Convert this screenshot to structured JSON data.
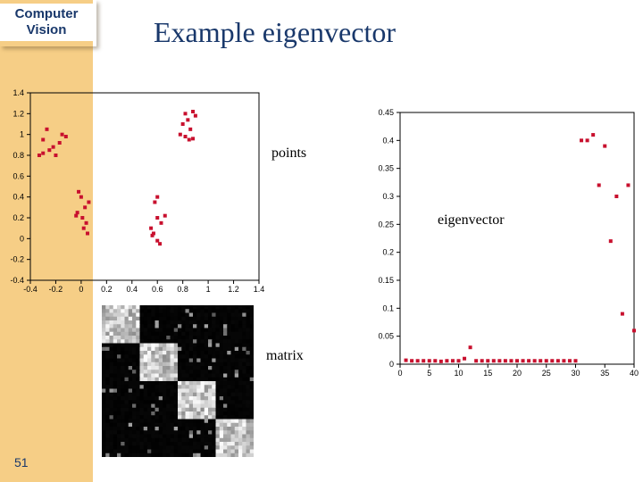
{
  "sidebar": {
    "title_line1": "Computer",
    "title_line2": "Vision",
    "page_number": "51"
  },
  "title": "Example eigenvector",
  "labels": {
    "points": "points",
    "eigenvector": "eigenvector",
    "matrix": "matrix"
  },
  "chart_data": [
    {
      "type": "scatter",
      "name": "points",
      "xlabel": "",
      "ylabel": "",
      "xlim": [
        -0.4,
        1.4
      ],
      "ylim": [
        -0.4,
        1.4
      ],
      "xticks": [
        -0.4,
        -0.2,
        0,
        0.2,
        0.4,
        0.6,
        0.8,
        1,
        1.2,
        1.4
      ],
      "yticks": [
        -0.4,
        -0.2,
        0,
        0.2,
        0.4,
        0.6,
        0.8,
        1,
        1.2,
        1.4
      ],
      "x": [
        -0.33,
        -0.3,
        -0.25,
        -0.27,
        -0.2,
        -0.15,
        -0.17,
        -0.12,
        -0.22,
        -0.3,
        -0.04,
        -0.02,
        0.02,
        0.03,
        0.05,
        -0.03,
        0.0,
        0.04,
        0.06,
        0.01,
        0.56,
        0.6,
        0.62,
        0.58,
        0.55,
        0.66,
        0.6,
        0.63,
        0.6,
        0.57,
        0.78,
        0.82,
        0.85,
        0.8,
        0.88,
        0.9,
        0.82,
        0.86,
        0.84,
        0.88
      ],
      "y": [
        0.8,
        0.95,
        0.85,
        1.05,
        0.8,
        1.0,
        0.92,
        0.98,
        0.88,
        0.82,
        0.22,
        0.45,
        0.1,
        0.3,
        0.05,
        0.25,
        0.4,
        0.15,
        0.35,
        0.2,
        0.03,
        0.2,
        -0.05,
        0.35,
        0.1,
        0.22,
        -0.02,
        0.15,
        0.4,
        0.05,
        1.0,
        1.2,
        0.95,
        1.1,
        0.96,
        1.18,
        0.98,
        1.05,
        1.14,
        1.22
      ]
    },
    {
      "type": "scatter",
      "name": "eigenvector",
      "xlabel": "",
      "ylabel": "",
      "xlim": [
        0,
        40
      ],
      "ylim": [
        0,
        0.45
      ],
      "xticks": [
        0,
        5,
        10,
        15,
        20,
        25,
        30,
        35,
        40
      ],
      "yticks": [
        0,
        0.05,
        0.1,
        0.15,
        0.2,
        0.25,
        0.3,
        0.35,
        0.4,
        0.45
      ],
      "x": [
        1,
        2,
        3,
        4,
        5,
        6,
        7,
        8,
        9,
        10,
        11,
        12,
        13,
        14,
        15,
        16,
        17,
        18,
        19,
        20,
        21,
        22,
        23,
        24,
        25,
        26,
        27,
        28,
        29,
        30,
        31,
        32,
        33,
        34,
        35,
        36,
        37,
        38,
        39,
        40
      ],
      "y": [
        0.007,
        0.006,
        0.006,
        0.006,
        0.006,
        0.006,
        0.005,
        0.006,
        0.006,
        0.006,
        0.01,
        0.03,
        0.006,
        0.006,
        0.006,
        0.006,
        0.006,
        0.006,
        0.006,
        0.006,
        0.006,
        0.006,
        0.006,
        0.006,
        0.006,
        0.006,
        0.006,
        0.006,
        0.006,
        0.006,
        0.4,
        0.4,
        0.41,
        0.32,
        0.39,
        0.22,
        0.3,
        0.09,
        0.32,
        0.06
      ]
    },
    {
      "type": "heatmap",
      "name": "affinity-matrix",
      "size": 40,
      "block_size": 10,
      "notes": "40x40 symmetric affinity — 4 dense 10x10 blocks on the diagonal, sparse noise elsewhere"
    }
  ]
}
